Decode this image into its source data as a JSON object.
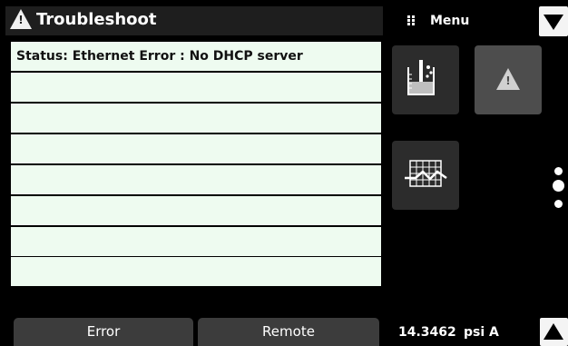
{
  "header": {
    "title": "Troubleshoot",
    "menu_label": "Menu"
  },
  "status_table": {
    "rows": [
      "Status: Ethernet Error : No DHCP server",
      "",
      "",
      "",
      "",
      "",
      "",
      ""
    ]
  },
  "tiles": [
    {
      "icon": "beaker-icon"
    },
    {
      "icon": "warning-icon"
    },
    {
      "icon": "chart-grid-icon"
    }
  ],
  "bottom": {
    "tabs": [
      "Error",
      "Remote"
    ],
    "reading_value": "14.3462",
    "reading_unit": "psi A"
  },
  "colors": {
    "background": "#000000",
    "row_background": "#eefbf0",
    "tile": "#2c2c2c",
    "tile_active": "#4d4d4d",
    "tab": "#3c3c3c"
  }
}
